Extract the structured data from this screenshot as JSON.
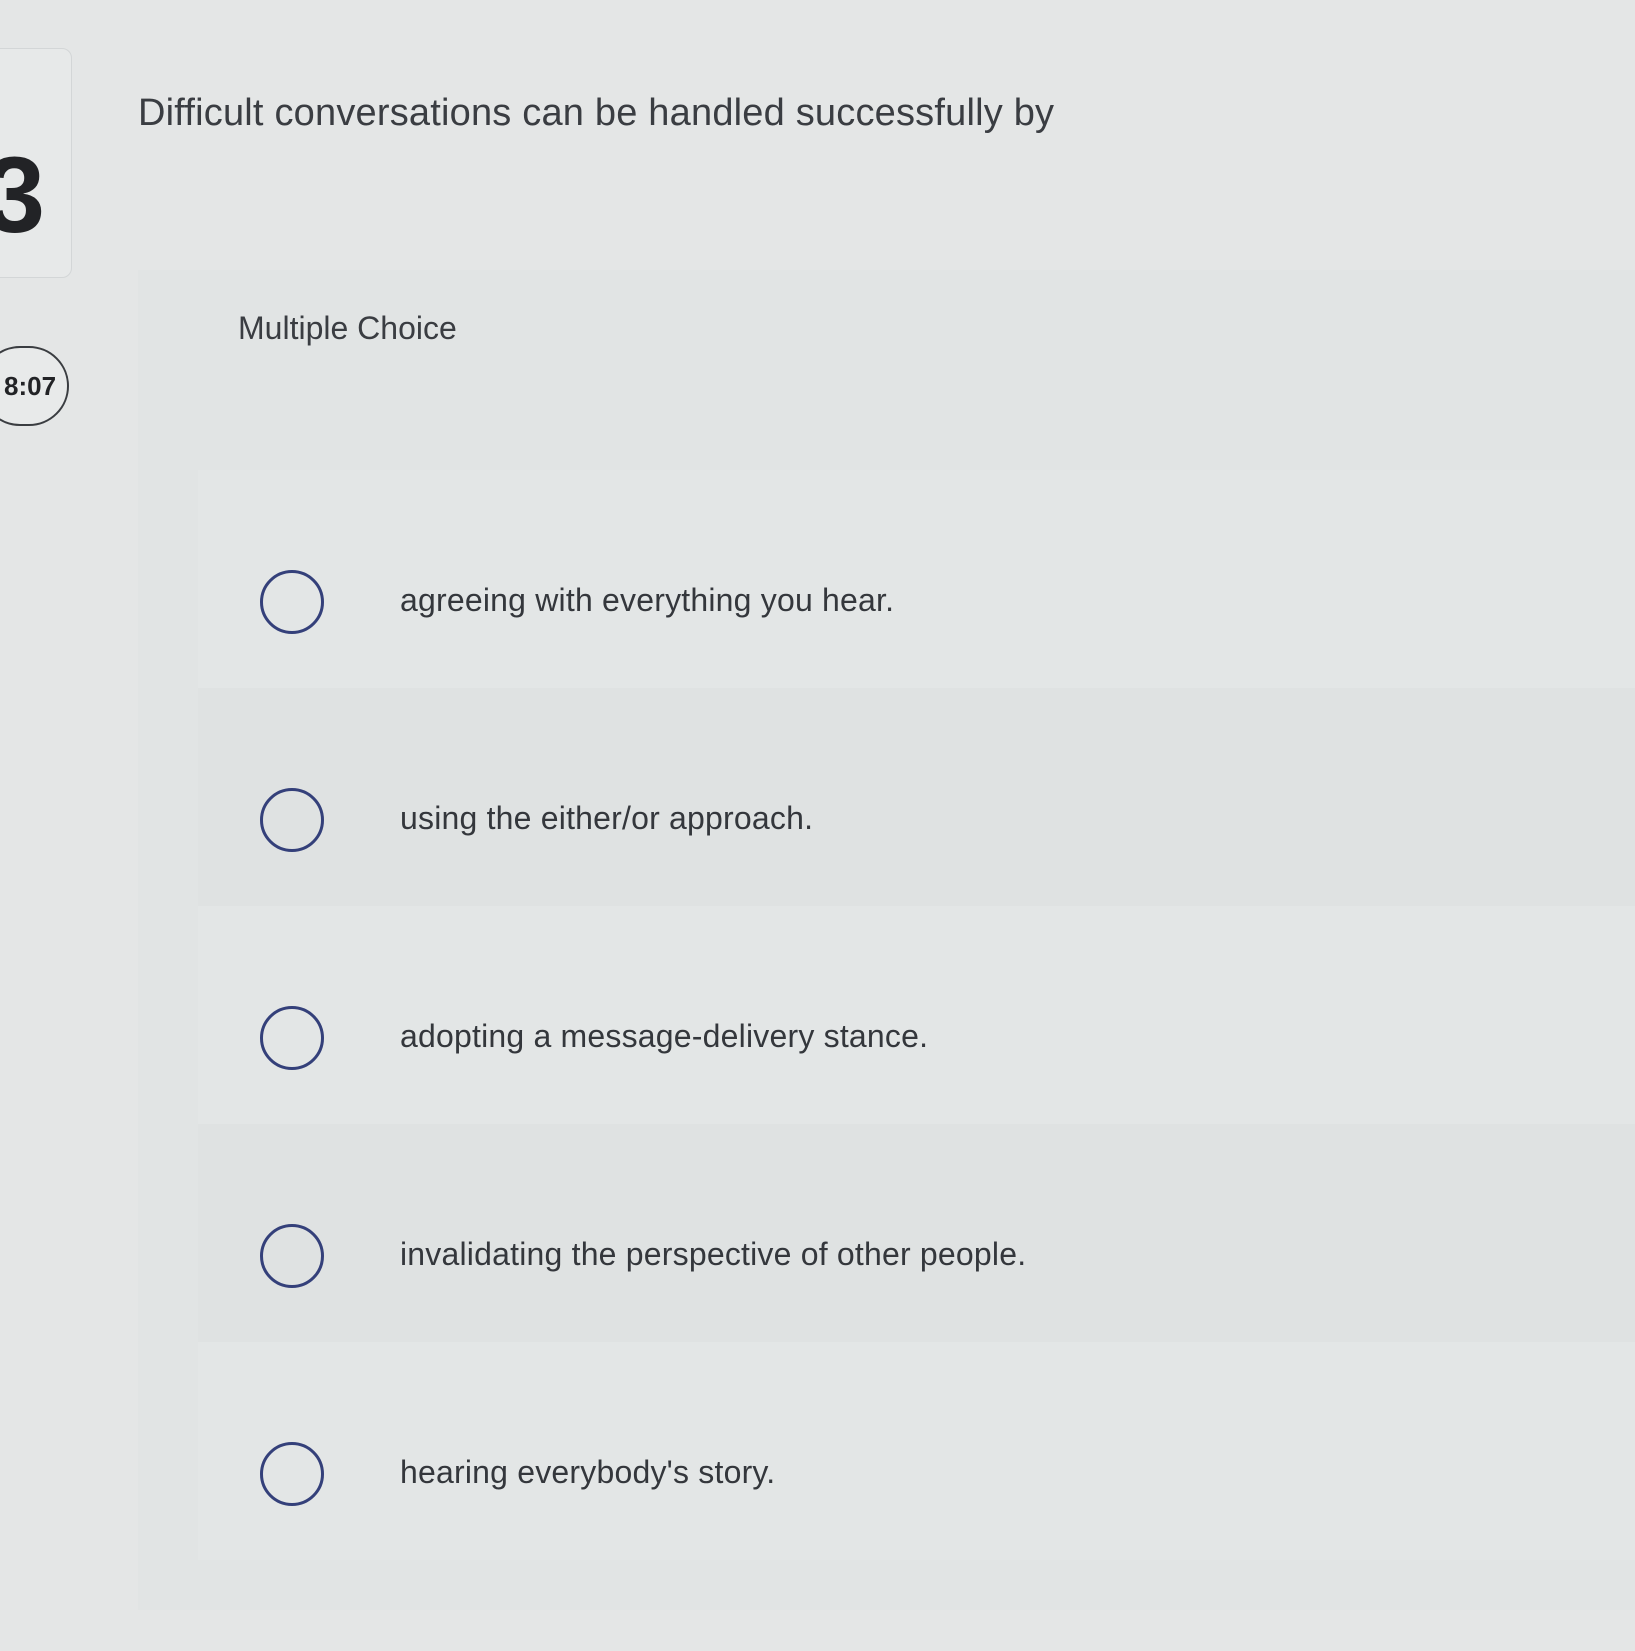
{
  "sidebar": {
    "question_number": "3",
    "timer": "8:07"
  },
  "question": {
    "prompt": "Difficult conversations can be handled successfully by",
    "type_label": "Multiple Choice",
    "options": [
      {
        "label": "agreeing with everything you hear."
      },
      {
        "label": "using the either/or approach."
      },
      {
        "label": "adopting a message-delivery stance."
      },
      {
        "label": "invalidating the perspective of other people."
      },
      {
        "label": "hearing everybody's story."
      }
    ]
  },
  "colors": {
    "background": "#e4e6e6",
    "radio_border": "#34407a",
    "text": "#34373c"
  }
}
